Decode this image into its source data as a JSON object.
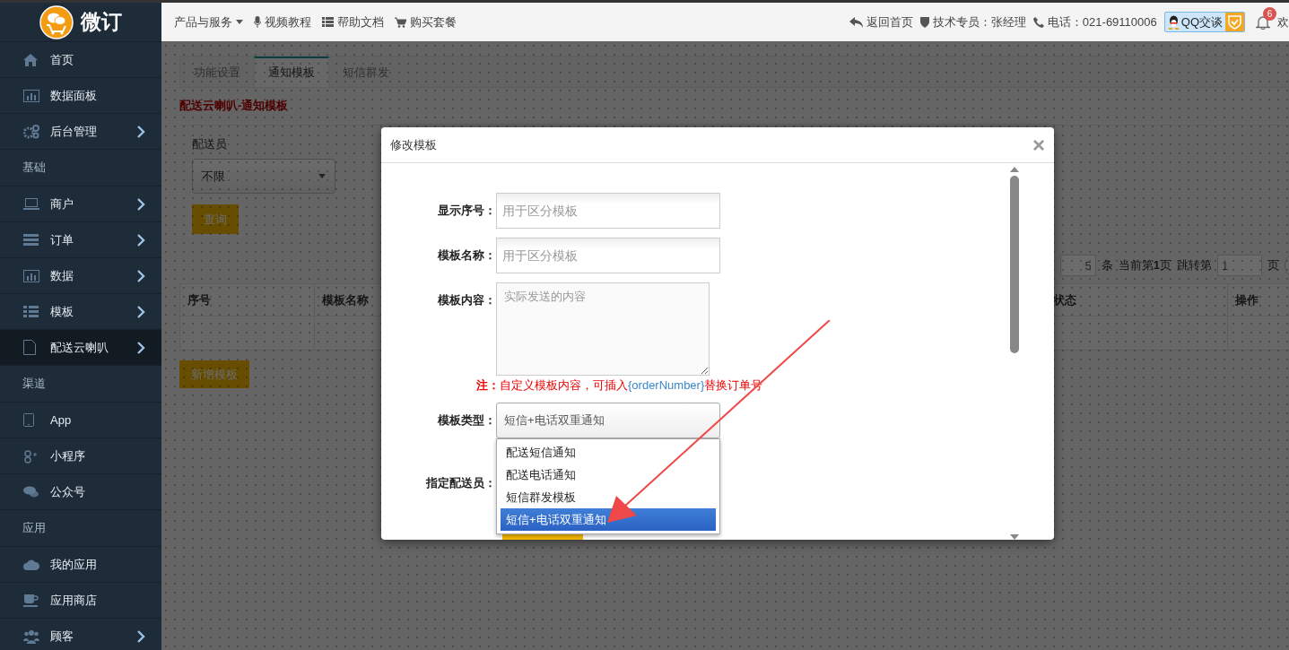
{
  "logo": {
    "text": "微订"
  },
  "sidebar": {
    "items": [
      {
        "kind": "item",
        "label": "首页",
        "expandable": false,
        "selected": false
      },
      {
        "kind": "item",
        "label": "数据面板",
        "expandable": false,
        "selected": false
      },
      {
        "kind": "item",
        "label": "后台管理",
        "expandable": true,
        "selected": false
      },
      {
        "kind": "section",
        "label": "基础"
      },
      {
        "kind": "item",
        "label": "商户",
        "expandable": true,
        "selected": false
      },
      {
        "kind": "item",
        "label": "订单",
        "expandable": true,
        "selected": false
      },
      {
        "kind": "item",
        "label": "数据",
        "expandable": true,
        "selected": false
      },
      {
        "kind": "item",
        "label": "模板",
        "expandable": true,
        "selected": false
      },
      {
        "kind": "item",
        "label": "配送云喇叭",
        "expandable": true,
        "selected": true
      },
      {
        "kind": "section",
        "label": "渠道"
      },
      {
        "kind": "item",
        "label": "App",
        "expandable": false,
        "selected": false
      },
      {
        "kind": "item",
        "label": "小程序",
        "expandable": false,
        "selected": false
      },
      {
        "kind": "item",
        "label": "公众号",
        "expandable": false,
        "selected": false
      },
      {
        "kind": "section",
        "label": "应用"
      },
      {
        "kind": "item",
        "label": "我的应用",
        "expandable": false,
        "selected": false
      },
      {
        "kind": "item",
        "label": "应用商店",
        "expandable": false,
        "selected": false
      },
      {
        "kind": "item",
        "label": "顾客",
        "expandable": true,
        "selected": false
      }
    ]
  },
  "topbar": {
    "nav": [
      {
        "label": "产品与服务",
        "dropdown": true
      },
      {
        "label": "视频教程",
        "dropdown": false
      },
      {
        "label": "帮助文档",
        "dropdown": false
      },
      {
        "label": "购买套餐",
        "dropdown": false
      }
    ],
    "home_link": "返回首页",
    "support": "技术专员：张经理",
    "phone": "电话：021-69110006",
    "qq_button": "QQ交谈",
    "notification_count": "6",
    "welcome": "欢"
  },
  "content": {
    "tabs": [
      {
        "label": "功能设置",
        "selected": false
      },
      {
        "label": "通知模板",
        "selected": true
      },
      {
        "label": "短信群发",
        "selected": false
      }
    ],
    "page_title": "配送云喇叭-通知模板",
    "filter": {
      "label": "配送员",
      "value": "不限",
      "button": "查询"
    },
    "pagination": {
      "page_size": "5",
      "unit": "条",
      "current": "当前第**1**页",
      "jump_label": "跳转第",
      "jump_value": "1",
      "page_unit": "页"
    },
    "table": {
      "columns": [
        "序号",
        "模板名称",
        "状态",
        "操作"
      ]
    },
    "add_button": "新增模板"
  },
  "modal": {
    "title": "修改模板",
    "close": "×",
    "fields": [
      {
        "kind": "input",
        "label": "显示序号：",
        "placeholder": "用于区分模板"
      },
      {
        "kind": "input",
        "label": "模板名称：",
        "placeholder": "用于区分模板"
      },
      {
        "kind": "textarea",
        "label": "模板内容：",
        "placeholder": "实际发送的内容"
      },
      {
        "kind": "note",
        "prefix": "注：",
        "text": "自定义模板内容，可插入",
        "token": "{orderNumber}",
        "suffix": "替换订单号"
      },
      {
        "kind": "select",
        "label": "模板类型：",
        "value": "短信+电话双重通知",
        "expanded": true,
        "options": [
          {
            "label": "配送短信通知",
            "selected": false
          },
          {
            "label": "配送电话通知",
            "selected": false
          },
          {
            "label": "短信群发模板",
            "selected": false
          },
          {
            "label": "短信+电话双重通知",
            "selected": true
          }
        ]
      },
      {
        "kind": "label",
        "label": "指定配送员："
      }
    ]
  },
  "annotation": {
    "kind": "arrow"
  }
}
